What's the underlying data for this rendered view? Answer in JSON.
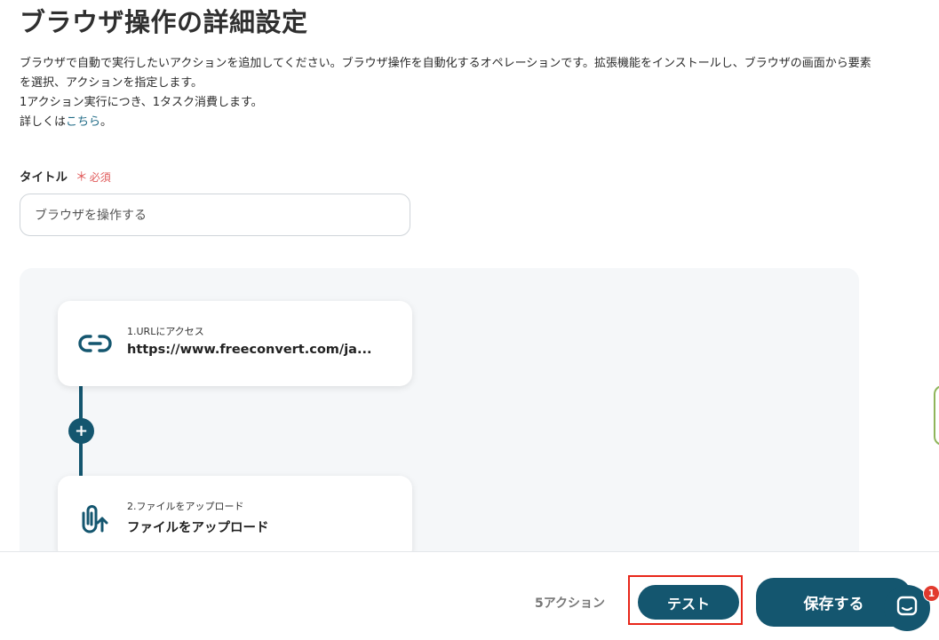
{
  "page": {
    "title": "ブラウザ操作の詳細設定",
    "description": {
      "line1": "ブラウザで自動で実行したいアクションを追加してください。ブラウザ操作を自動化するオペレーションです。拡張機能をインストールし、ブラウザの画面から要素を選択、アクションを指定します。",
      "line2": "1アクション実行につき、1タスク消費します。",
      "line3_prefix": "詳しくは",
      "line3_link": "こちら",
      "line3_suffix": "。"
    }
  },
  "form": {
    "title_label": "タイトル",
    "required_star": "＊",
    "required_text": "必須",
    "title_value": "ブラウザを操作する"
  },
  "flow": {
    "steps": [
      {
        "icon": "link-icon",
        "sub": "1.URLにアクセス",
        "main": "https://www.freeconvert.com/ja..."
      },
      {
        "icon": "paperclip-upload-icon",
        "sub": "2.ファイルをアップロード",
        "main": "ファイルをアップロード"
      }
    ],
    "add_label": "+"
  },
  "footer": {
    "action_count": "5アクション",
    "test_label": "テスト",
    "save_label": "保存する",
    "chat_badge": "1"
  },
  "colors": {
    "primary": "#14566f",
    "required": "#e05a5a",
    "link": "#1f6a86",
    "highlight": "#e8261a",
    "badge": "#e23a2e"
  }
}
